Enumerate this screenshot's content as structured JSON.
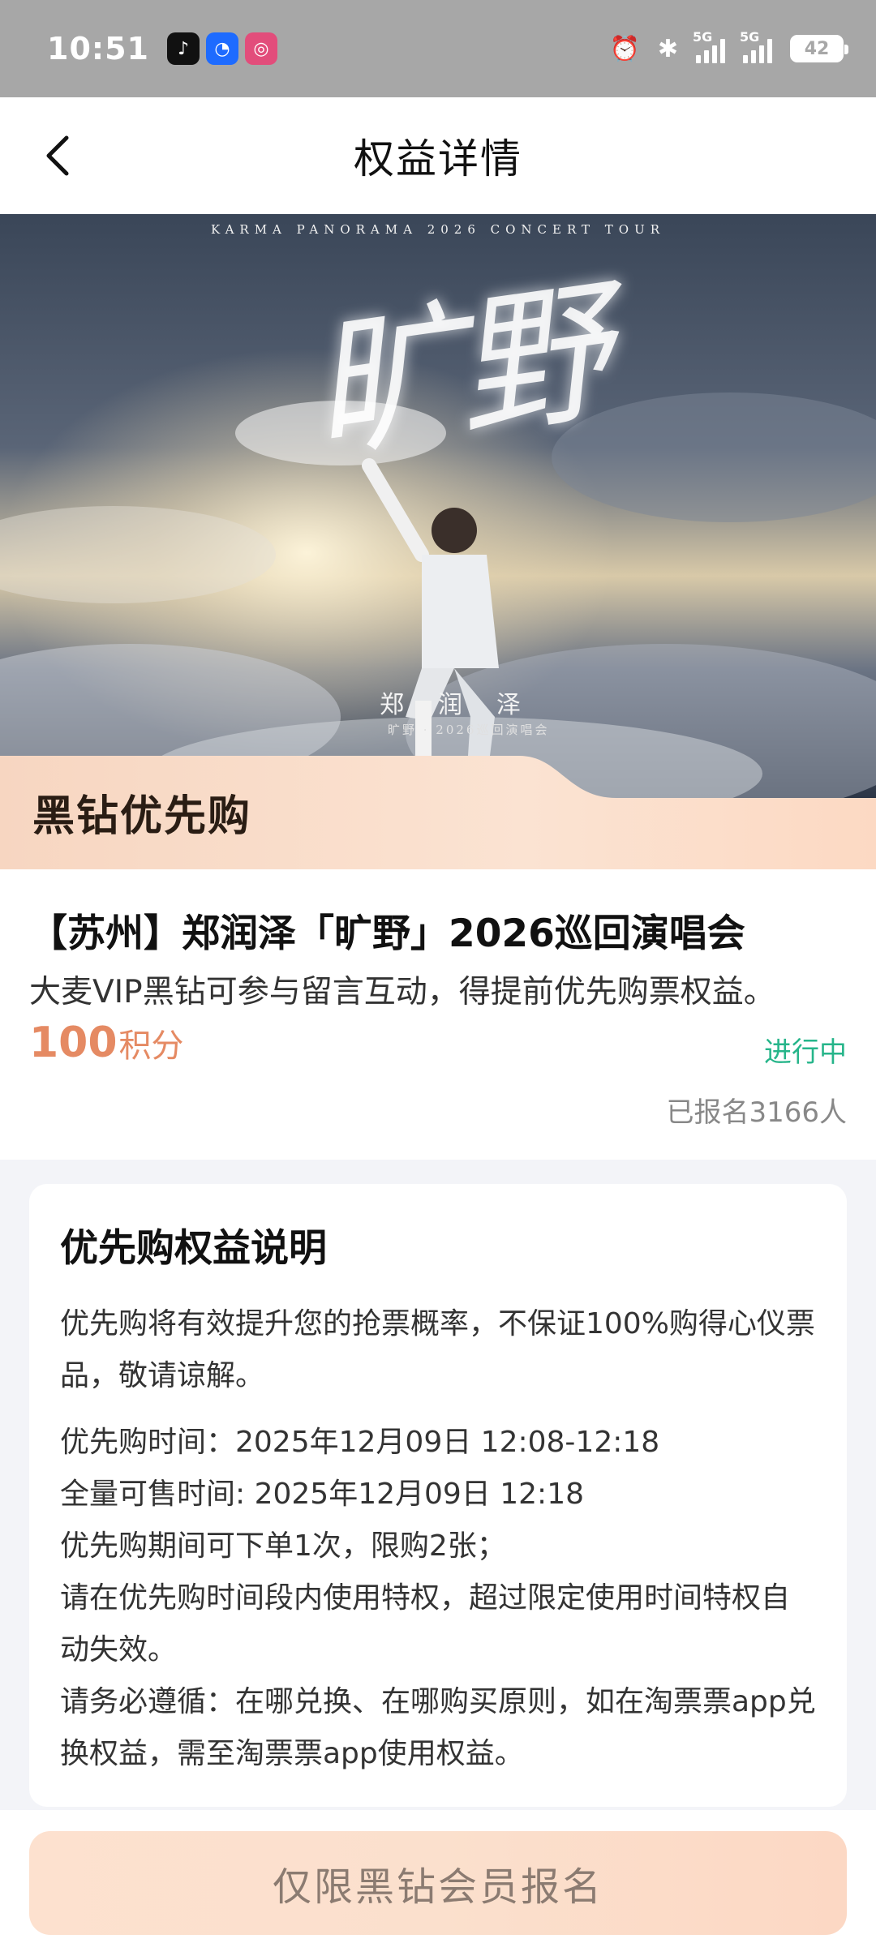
{
  "status_bar": {
    "time": "10:51",
    "apps": [
      "tiktok-icon",
      "taobao-icon",
      "china-mobile-icon"
    ],
    "network_1": "5G",
    "network_2": "5G",
    "battery": "42"
  },
  "nav": {
    "title": "权益详情",
    "back_icon": "chevron-left-icon"
  },
  "banner": {
    "tour_line": "KARMA      PANORAMA      2026      CONCERT TOUR",
    "title_art": "旷野",
    "artist_name": "郑润泽",
    "artist_sub": "旷野 · 2026巡回演唱会",
    "label": "黑钻优先购"
  },
  "event": {
    "title": "【苏州】郑润泽「旷野」2026巡回演唱会",
    "description": "大麦VIP黑钻可参与留言互动，得提前优先购票权益。",
    "points_value": "100",
    "points_unit": "积分",
    "status": "进行中",
    "signup_count": "已报名3166人"
  },
  "rules": {
    "title": "优先购权益说明",
    "intro": "优先购将有效提升您的抢票概率，不保证100%购得心仪票品，敬请谅解。",
    "lines": [
      "优先购时间：2025年12月09日 12:08-12:18",
      "全量可售时间: 2025年12月09日 12:18",
      "优先购期间可下单1次，限购2张；",
      "请在优先购时间段内使用特权，超过限定使用时间特权自动失效。",
      "请务必遵循：在哪兑换、在哪购买原则，如在淘票票app兑换权益，需至淘票票app使用权益。"
    ]
  },
  "bottom": {
    "button_label": "仅限黑钻会员报名"
  },
  "colors": {
    "accent_orange": "#e58a63",
    "status_green": "#26b58a",
    "button_bg": "#fde1cf"
  }
}
